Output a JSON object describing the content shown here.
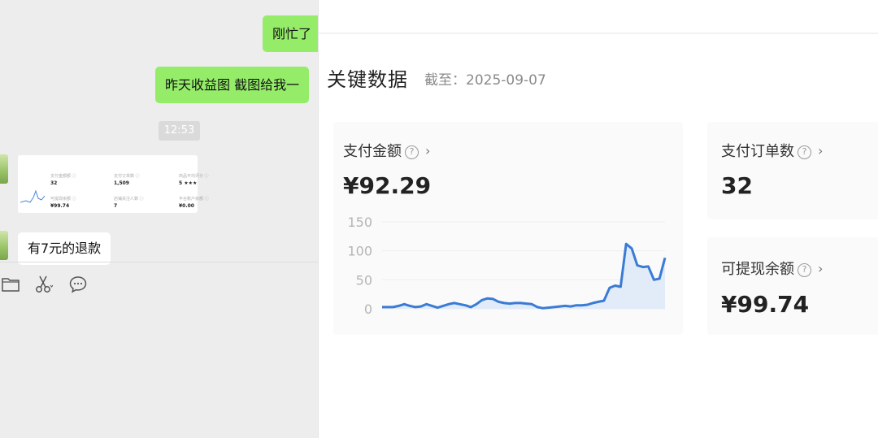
{
  "chat": {
    "messages_me": [
      {
        "text": "刚忙了"
      },
      {
        "text": "昨天收益图 截图给我一"
      }
    ],
    "timestamp": "12:53",
    "thumbnail": {
      "labels": [
        "支付金额额 ⓘ",
        "支付订单数 ⓘ",
        "商品平均评分 ⓘ",
        "可提现余额 ⓘ",
        "店铺关注人数 ⓘ",
        "平台账户余额 ⓘ"
      ],
      "values": [
        "32",
        "1,509",
        "5 ★★★",
        "¥99.74",
        "7",
        "¥0.00"
      ]
    },
    "message_other": "有7元的退款",
    "toolbar_icons": [
      "folder-icon",
      "scissors-icon",
      "chat-bubble-icon"
    ]
  },
  "screenshot": {
    "title": "关键数据",
    "cutoff_label": "截至：2025-09-07",
    "cards": {
      "pay_amount": {
        "label": "支付金额",
        "value": "¥92.29"
      },
      "pay_orders": {
        "label": "支付订单数",
        "value": "32"
      },
      "withdrawable": {
        "label": "可提现余额",
        "value": "¥99.74"
      }
    },
    "help_glyph": "?",
    "chevron_glyph": "›"
  },
  "chart_data": {
    "type": "area",
    "title": "",
    "xlabel": "",
    "ylabel": "",
    "ylim": [
      0,
      150
    ],
    "yticks": [
      150,
      100,
      50,
      0
    ],
    "grid": true,
    "color": "#3a7bd5",
    "series": [
      {
        "values": [
          3,
          3,
          3,
          5,
          8,
          5,
          3,
          4,
          8,
          5,
          2,
          5,
          8,
          10,
          8,
          6,
          3,
          8,
          15,
          18,
          17,
          12,
          10,
          9,
          10,
          10,
          9,
          8,
          3,
          1,
          2,
          3,
          4,
          5,
          4,
          6,
          6,
          7,
          10,
          12,
          14,
          36,
          40,
          38,
          112,
          104,
          75,
          72,
          73,
          50,
          52,
          88
        ]
      }
    ]
  },
  "colors": {
    "chat_bg": "#ededed",
    "bubble_me": "#95ec69",
    "bubble_other": "#ffffff",
    "line": "#3a7bd5",
    "fill": "#dde9f8"
  }
}
